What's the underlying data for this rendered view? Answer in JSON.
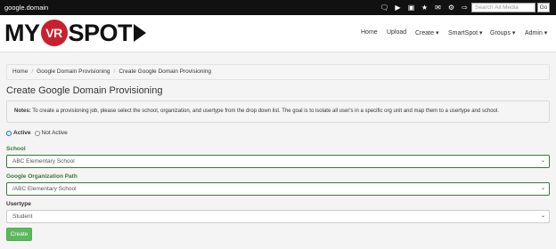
{
  "topbar": {
    "domain": "google.domain",
    "icons": [
      "chat-icon",
      "youtube-icon",
      "vr-icon",
      "star-icon",
      "mail-icon",
      "settings-icon",
      "logout-icon"
    ],
    "search_placeholder": "Search All Media",
    "go_label": "Go"
  },
  "header": {
    "logo_text_left": "MY",
    "logo_text_vr": "VR",
    "logo_text_right": "SPOT",
    "nav": {
      "home": "Home",
      "upload": "Upload",
      "create": "Create ▾",
      "smartspot": "SmartSpot ▾",
      "groups": "Groups ▾",
      "admin": "Admin ▾"
    }
  },
  "breadcrumb": {
    "items": [
      "Home",
      "Google Domain Provisioning",
      "Create Google Domain Provisioning"
    ]
  },
  "page": {
    "title": "Create Google Domain Provisioning",
    "notes_label": "Notes:",
    "notes_text": " To create a provisioning job, please select the school, organization, and usertype from the drop down list. The goal is to isolate all user's in a specific org unit and map them to a usertype and school."
  },
  "form": {
    "status": {
      "active_label": "Active",
      "not_active_label": "Not Active",
      "selected": "Active"
    },
    "school": {
      "label": "School",
      "value": "ABC Elementary School"
    },
    "org_path": {
      "label": "Google Organization Path",
      "value": "/ABC Elementary School"
    },
    "usertype": {
      "label": "Usertype",
      "value": "Student"
    },
    "create_label": "Create"
  },
  "colors": {
    "topbar_bg": "#111111",
    "logo_red": "#c8202f",
    "valid_green": "#3c763d",
    "button_green": "#5cb85c"
  }
}
